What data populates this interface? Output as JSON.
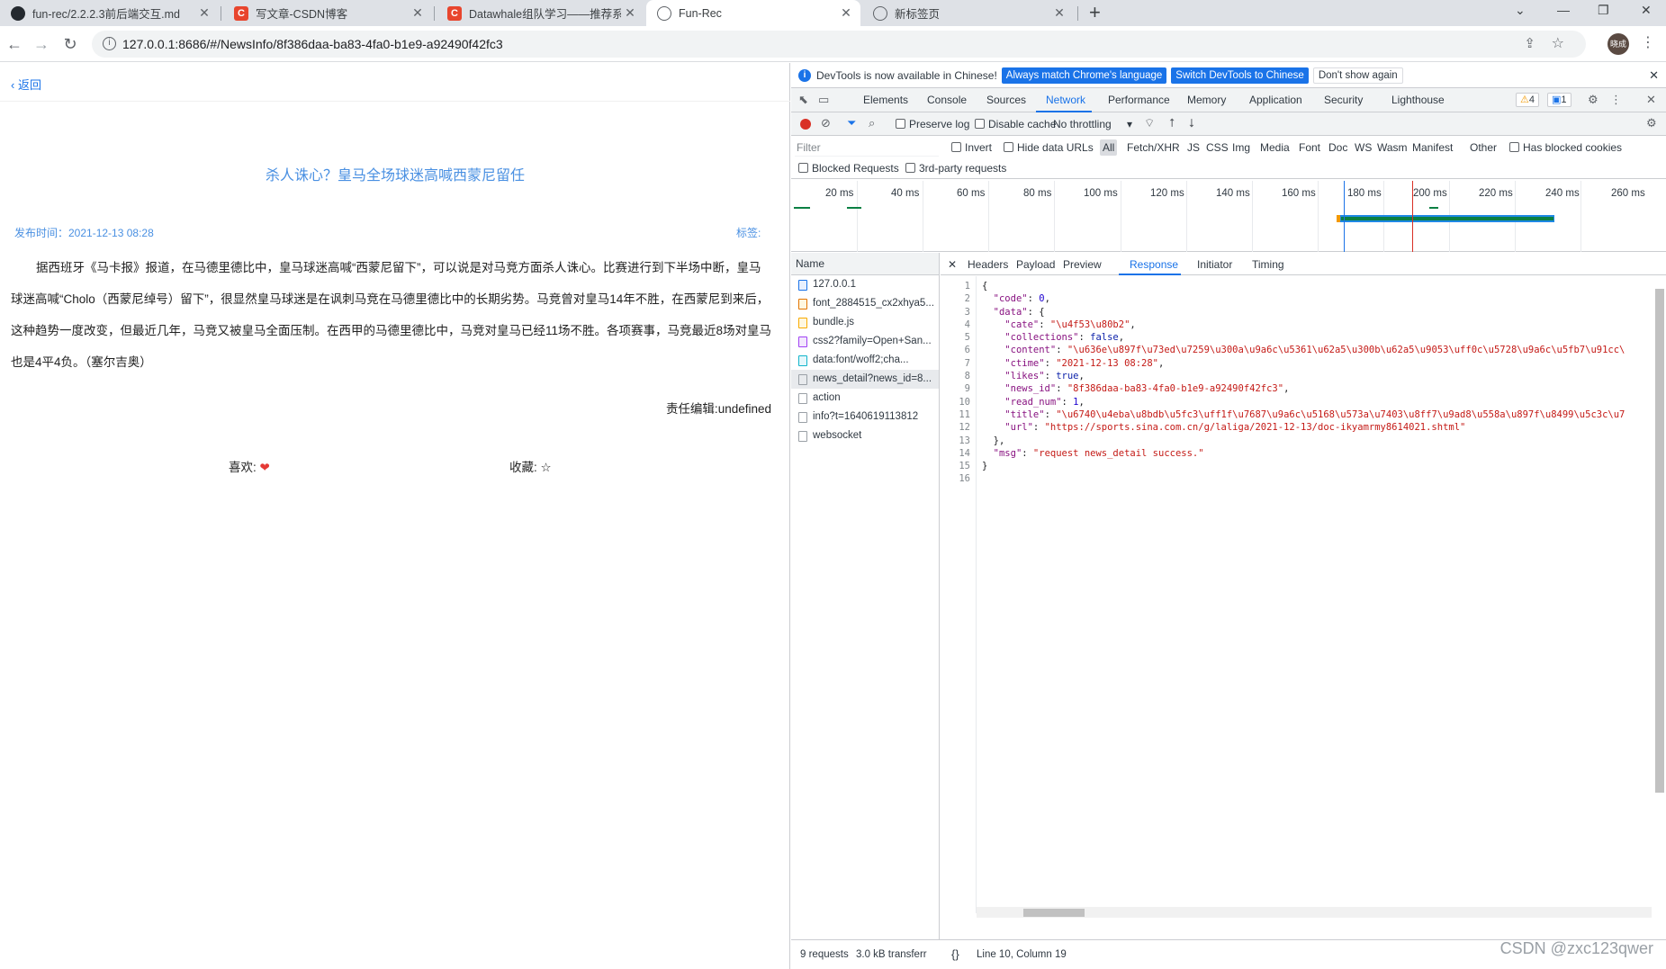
{
  "browser": {
    "tabs": [
      {
        "title": "fun-rec/2.2.2.3前后端交互.md",
        "favicon": "github-icon"
      },
      {
        "title": "写文章-CSDN博客",
        "favicon": "csdn-icon"
      },
      {
        "title": "Datawhale组队学习——推荐系",
        "favicon": "csdn-icon"
      },
      {
        "title": "Fun-Rec",
        "favicon": "globe-icon",
        "active": true
      },
      {
        "title": "新标签页",
        "favicon": "globe-icon"
      }
    ],
    "url": "127.0.0.1:8686/#/NewsInfo/8f386daa-ba83-4fa0-b1e9-a92490f42fc3",
    "avatar_text": "晓成"
  },
  "page": {
    "back_label": "返回",
    "title": "杀人诛心？皇马全场球迷高喊西蒙尼留任",
    "publish_label": "发布时间：2021-12-13 08:28",
    "tags_label": "标签:",
    "article": "据西班牙《马卡报》报道，在马德里德比中，皇马球迷高喊“西蒙尼留下”，可以说是对马竞方面杀人诛心。比赛进行到下半场中断，皇马球迷高喊“Cholo（西蒙尼绰号）留下”，很显然皇马球迷是在讽刺马竞在马德里德比中的长期劣势。马竞曾对皇马14年不胜，在西蒙尼到来后，这种趋势一度改变，但最近几年，马竞又被皇马全面压制。在西甲的马德里德比中，马竞对皇马已经11场不胜。各项赛事，马竞最近8场对皇马也是4平4负。（塞尔吉奥）",
    "editor_label": "责任编辑:undefined",
    "likes_label": "喜欢:",
    "collect_label": "收藏:"
  },
  "devtools": {
    "infobar": {
      "message": "DevTools is now available in Chinese!",
      "btn_match": "Always match Chrome's language",
      "btn_switch": "Switch DevTools to Chinese",
      "btn_dismiss": "Don't show again"
    },
    "panels": [
      "Elements",
      "Console",
      "Sources",
      "Network",
      "Performance",
      "Memory",
      "Application",
      "Security",
      "Lighthouse"
    ],
    "active_panel": "Network",
    "warnings_badge": "4",
    "messages_badge": "1",
    "toolbar": {
      "preserve_log": "Preserve log",
      "disable_cache": "Disable cache",
      "throttling": "No throttling"
    },
    "filter": {
      "placeholder": "Filter",
      "invert": "Invert",
      "hide_data_urls": "Hide data URLs",
      "types": [
        "All",
        "Fetch/XHR",
        "JS",
        "CSS",
        "Img",
        "Media",
        "Font",
        "Doc",
        "WS",
        "Wasm",
        "Manifest",
        "Other"
      ],
      "has_blocked_cookies": "Has blocked cookies",
      "blocked_requests": "Blocked Requests",
      "third_party": "3rd-party requests"
    },
    "timeline_labels": [
      "20 ms",
      "40 ms",
      "60 ms",
      "80 ms",
      "100 ms",
      "120 ms",
      "140 ms",
      "160 ms",
      "180 ms",
      "200 ms",
      "220 ms",
      "240 ms",
      "260 ms"
    ],
    "request_list_header": "Name",
    "requests": [
      {
        "name": "127.0.0.1",
        "type": "doc"
      },
      {
        "name": "font_2884515_cx2xhya5...",
        "type": "font"
      },
      {
        "name": "bundle.js",
        "type": "js"
      },
      {
        "name": "css2?family=Open+San...",
        "type": "css"
      },
      {
        "name": "data:font/woff2;cha...",
        "type": "data"
      },
      {
        "name": "news_detail?news_id=8...",
        "type": "xhr",
        "selected": true
      },
      {
        "name": "action",
        "type": "xhr"
      },
      {
        "name": "info?t=1640619113812",
        "type": "xhr"
      },
      {
        "name": "websocket",
        "type": "xhr"
      }
    ],
    "detail_tabs": [
      "Headers",
      "Payload",
      "Preview",
      "Response",
      "Initiator",
      "Timing"
    ],
    "active_detail_tab": "Response",
    "response_line_numbers": [
      "1",
      "2",
      "3",
      "4",
      "5",
      "6",
      "7",
      "8",
      "9",
      "10",
      "11",
      "12",
      "13",
      "14",
      "15",
      "16"
    ],
    "status": {
      "requests": "9 requests",
      "transferred": "3.0 kB transferr",
      "position": "Line 10, Column 19"
    },
    "watermark": "CSDN @zxc123qwer"
  }
}
